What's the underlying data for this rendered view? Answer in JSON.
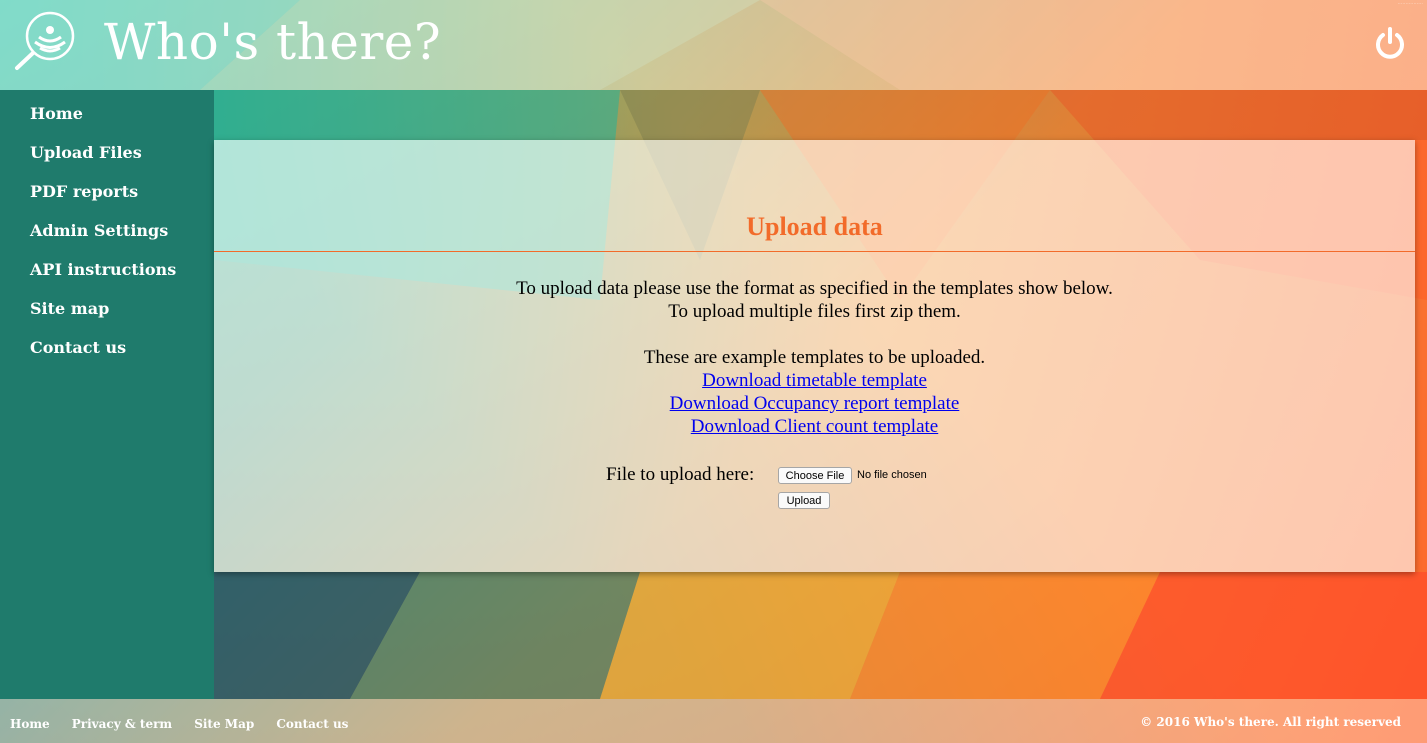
{
  "header": {
    "site_title": "Who's there?",
    "logo_icon": "radar-magnifier-icon",
    "power_icon": "power-icon",
    "corner_text": "................"
  },
  "sidebar": {
    "items": [
      {
        "label": "Home"
      },
      {
        "label": "Upload Files"
      },
      {
        "label": "PDF reports"
      },
      {
        "label": "Admin Settings"
      },
      {
        "label": "API instructions"
      },
      {
        "label": "Site map"
      },
      {
        "label": "Contact us"
      }
    ]
  },
  "main": {
    "title": "Upload data",
    "intro_line1": "To upload data please use the format as specified in the templates show below.",
    "intro_line2": "To upload multiple files first zip them.",
    "templates_heading": "These are example templates to be uploaded.",
    "links": [
      {
        "label": "Download timetable template"
      },
      {
        "label": "Download Occupancy report template"
      },
      {
        "label": "Download Client count template"
      }
    ],
    "file_label": "File to upload here:",
    "choose_file_label": "Choose File",
    "no_file_text": "No file chosen",
    "upload_label": "Upload"
  },
  "footer": {
    "links": [
      {
        "label": "Home"
      },
      {
        "label": "Privacy & term"
      },
      {
        "label": "Site Map"
      },
      {
        "label": "Contact us"
      }
    ],
    "copyright": "© 2016 Who's there. All right reserved"
  },
  "colors": {
    "sidebar": "#1f7b6c",
    "accent": "#f26b2a",
    "link": "#0000ee"
  }
}
